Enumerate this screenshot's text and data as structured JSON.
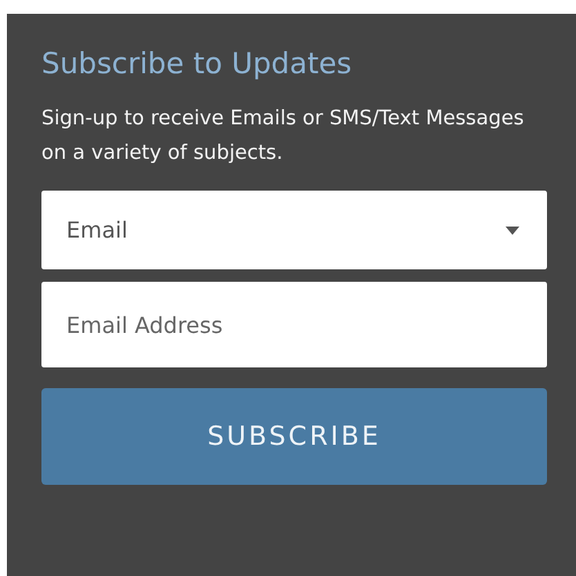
{
  "title": "Subscribe to Updates",
  "description": "Sign-up to receive Emails or SMS/Text Messages on a variety of subjects.",
  "method_select": {
    "value": "Email"
  },
  "email_field": {
    "placeholder": "Email Address"
  },
  "subscribe_button": {
    "label": "SUBSCRIBE"
  }
}
